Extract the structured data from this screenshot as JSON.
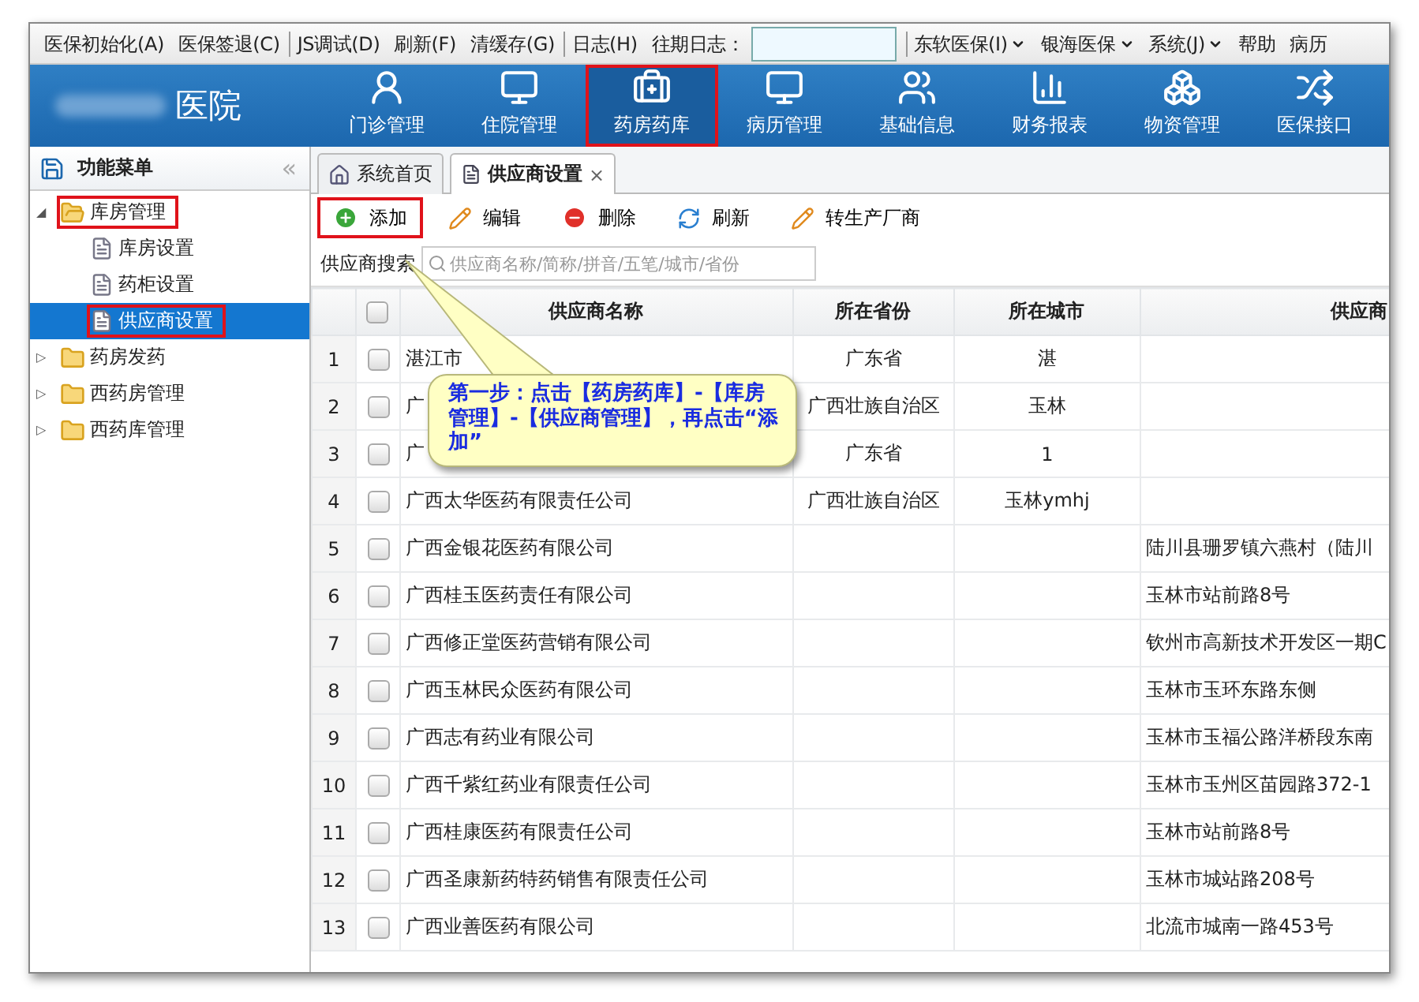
{
  "menu_bar": {
    "items": [
      {
        "label": "医保初始化(A)",
        "dropdown": false,
        "group_start": false
      },
      {
        "label": "医保签退(C)",
        "dropdown": false,
        "group_start": false
      },
      {
        "label": "JS调试(D)",
        "dropdown": false,
        "group_start": true
      },
      {
        "label": "刷新(F)",
        "dropdown": false,
        "group_start": false
      },
      {
        "label": "清缓存(G)",
        "dropdown": false,
        "group_start": false
      },
      {
        "label": "日志(H)",
        "dropdown": false,
        "group_start": true
      }
    ],
    "log_field_label": "往期日志：",
    "right_items": [
      {
        "label": "东软医保(I)",
        "dropdown": true,
        "group_start": true
      },
      {
        "label": "银海医保",
        "dropdown": true,
        "group_start": false
      },
      {
        "label": "系统(J)",
        "dropdown": true,
        "group_start": false
      },
      {
        "label": "帮助",
        "dropdown": false,
        "group_start": false
      },
      {
        "label": "病历",
        "dropdown": false,
        "group_start": false
      }
    ]
  },
  "header": {
    "hospital_name": "医院",
    "nav": [
      {
        "label": "门诊管理",
        "kind": "doctor",
        "selected": false,
        "highlighted": false
      },
      {
        "label": "住院管理",
        "kind": "monitor",
        "selected": false,
        "highlighted": false
      },
      {
        "label": "药房药库",
        "kind": "medkit",
        "selected": true,
        "highlighted": true
      },
      {
        "label": "病历管理",
        "kind": "monitor",
        "selected": false,
        "highlighted": false
      },
      {
        "label": "基础信息",
        "kind": "users",
        "selected": false,
        "highlighted": false
      },
      {
        "label": "财务报表",
        "kind": "chart",
        "selected": false,
        "highlighted": false
      },
      {
        "label": "物资管理",
        "kind": "boxes",
        "selected": false,
        "highlighted": false
      },
      {
        "label": "医保接口",
        "kind": "shuffle",
        "selected": false,
        "highlighted": false
      }
    ]
  },
  "sidebar": {
    "title": "功能菜单",
    "collapse": "«",
    "items": [
      {
        "label": "库房管理",
        "expander": "◢",
        "expanded": true,
        "selected": false,
        "highlighted": true,
        "children": [
          {
            "label": "库房设置",
            "selected": false,
            "highlighted": false
          },
          {
            "label": "药柜设置",
            "selected": false,
            "highlighted": false
          },
          {
            "label": "供应商设置",
            "selected": true,
            "highlighted": true
          }
        ]
      },
      {
        "label": "药房发药",
        "expander": "▷",
        "expanded": false,
        "selected": false,
        "highlighted": false
      },
      {
        "label": "西药房管理",
        "expander": "▷",
        "expanded": false,
        "selected": false,
        "highlighted": false
      },
      {
        "label": "西药库管理",
        "expander": "▷",
        "expanded": false,
        "selected": false,
        "highlighted": false
      }
    ]
  },
  "tabs": [
    {
      "label": "系统首页",
      "kind": "home",
      "selected": false
    },
    {
      "label": "供应商设置",
      "kind": "page",
      "selected": true,
      "close": "×"
    }
  ],
  "toolbar": [
    {
      "label": "添加",
      "kind": "add",
      "highlighted": true
    },
    {
      "label": "编辑",
      "kind": "edit",
      "highlighted": false
    },
    {
      "label": "删除",
      "kind": "delete",
      "highlighted": false
    },
    {
      "label": "刷新",
      "kind": "refresh",
      "highlighted": false
    },
    {
      "label": "转生产厂商",
      "kind": "edit",
      "highlighted": false
    }
  ],
  "search": {
    "label": "供应商搜索",
    "placeholder": "供应商名称/简称/拼音/五笔/城市/省份"
  },
  "table": {
    "select_all_checked": false,
    "columns": [
      "供应商名称",
      "所在省份",
      "所在城市",
      "供应商"
    ],
    "rows": [
      {
        "no": "1",
        "checked": false,
        "name": "湛江市",
        "province": "广东省",
        "city": "湛",
        "address": ""
      },
      {
        "no": "2",
        "checked": false,
        "name": "广",
        "province": "广西壮族自治区",
        "city": "玉林",
        "address": ""
      },
      {
        "no": "3",
        "checked": false,
        "name": "广",
        "province": "广东省",
        "city": "1",
        "address": ""
      },
      {
        "no": "4",
        "checked": false,
        "name": "广西太华医药有限责任公司",
        "province": "广西壮族自治区",
        "city": "玉林ymhj",
        "address": ""
      },
      {
        "no": "5",
        "checked": false,
        "name": "广西金银花医药有限公司",
        "province": "",
        "city": "",
        "address": "陆川县珊罗镇六燕村（陆川"
      },
      {
        "no": "6",
        "checked": false,
        "name": "广西桂玉医药责任有限公司",
        "province": "",
        "city": "",
        "address": "玉林市站前路8号"
      },
      {
        "no": "7",
        "checked": false,
        "name": "广西修正堂医药营销有限公司",
        "province": "",
        "city": "",
        "address": "钦州市高新技术开发区一期C"
      },
      {
        "no": "8",
        "checked": false,
        "name": "广西玉林民众医药有限公司",
        "province": "",
        "city": "",
        "address": "玉林市玉环东路东侧"
      },
      {
        "no": "9",
        "checked": false,
        "name": "广西志有药业有限公司",
        "province": "",
        "city": "",
        "address": "玉林市玉福公路洋桥段东南"
      },
      {
        "no": "10",
        "checked": false,
        "name": "广西千紫红药业有限责任公司",
        "province": "",
        "city": "",
        "address": "玉林市玉州区苗园路372-1"
      },
      {
        "no": "11",
        "checked": false,
        "name": "广西桂康医药有限责任公司",
        "province": "",
        "city": "",
        "address": "玉林市站前路8号"
      },
      {
        "no": "12",
        "checked": false,
        "name": "广西圣康新药特药销售有限责任公司",
        "province": "",
        "city": "",
        "address": "玉林市城站路208号"
      },
      {
        "no": "13",
        "checked": false,
        "name": "广西业善医药有限公司",
        "province": "",
        "city": "",
        "address": "北流市城南一路453号"
      }
    ]
  },
  "callout": {
    "text": "第一步：点击【药房药库】-【库房管理】-【供应商管理】，再点击“添加”"
  }
}
